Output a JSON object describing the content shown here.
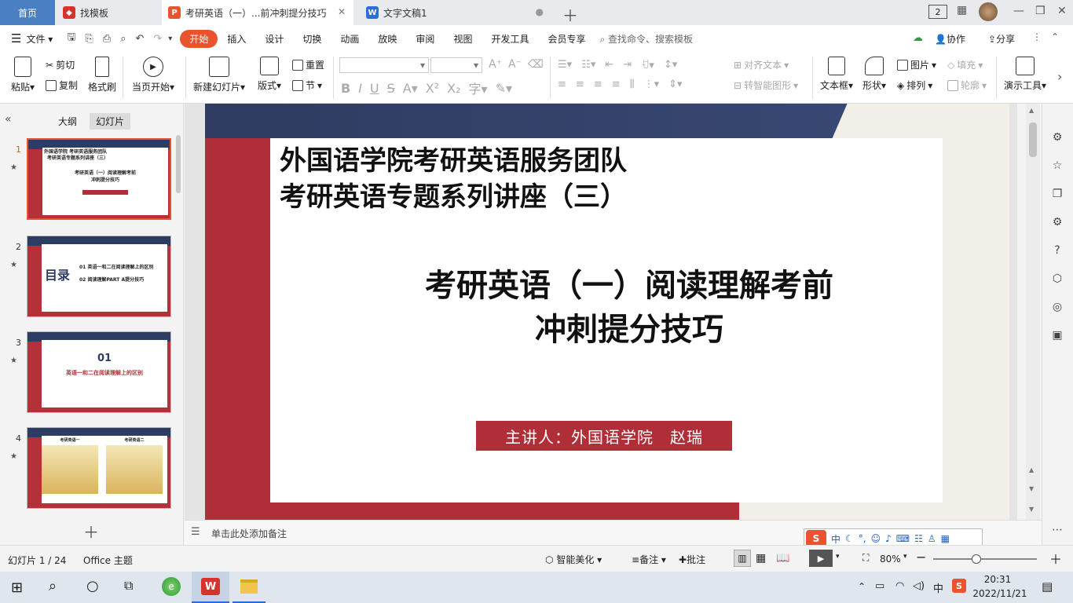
{
  "tabs": {
    "home": "首页",
    "template": "找模板",
    "active_doc": "考研英语（一）...前冲刺提分技巧",
    "text_doc": "文字文稿1"
  },
  "window": {
    "badge": "2"
  },
  "menu": {
    "file": "文件",
    "items": [
      "开始",
      "插入",
      "设计",
      "切换",
      "动画",
      "放映",
      "审阅",
      "视图",
      "开发工具",
      "会员专享"
    ],
    "search": "查找命令、搜索模板",
    "collab": "协作",
    "share": "分享"
  },
  "ribbon": {
    "paste": "粘贴",
    "cut": "剪切",
    "copy": "复制",
    "format_painter": "格式刷",
    "from_current": "当页开始",
    "new_slide": "新建幻灯片",
    "layout": "版式",
    "reset": "重置",
    "section": "节",
    "align_text": "对齐文本",
    "smart_shape": "转智能图形",
    "textbox": "文本框",
    "shape": "形状",
    "picture": "图片",
    "fill": "填充",
    "arrange": "排列",
    "outline": "轮廓",
    "presenter_tools": "演示工具"
  },
  "panel": {
    "outline_tab": "大纲",
    "slides_tab": "幻灯片",
    "thumbs": [
      {
        "num": "1",
        "line1": "外国语学院 考研英语服务团队",
        "line2": "考研英语专题系列讲座（三）",
        "line3": "考研英语（一）阅读理解考前",
        "line4": "冲刺提分技巧"
      },
      {
        "num": "2",
        "title": "目录",
        "item1": "01 英语一和二在阅读理解上的区别",
        "item2": "02 阅读理解PART A提分技巧"
      },
      {
        "num": "3",
        "big": "01",
        "sub": "英语一和二在阅读理解上的区别"
      },
      {
        "num": "4",
        "h1": "考研英语一",
        "h2": "考研英语二"
      }
    ]
  },
  "slide": {
    "title_line1": "外国语学院考研英语服务团队",
    "title_line2": "考研英语专题系列讲座（三）",
    "main_line1": "考研英语（一）阅读理解考前",
    "main_line2": "冲刺提分技巧",
    "lecturer": "主讲人：外国语学院　赵瑞"
  },
  "notes_placeholder": "单击此处添加备注",
  "status": {
    "slide_count": "幻灯片 1 / 24",
    "theme": "Office 主题",
    "beautify": "智能美化",
    "notes": "备注",
    "comments": "批注",
    "zoom": "80%",
    "zoom_fraction": 0.42
  },
  "ime": {
    "mode": "中"
  },
  "taskbar": {
    "ime": "中",
    "time": "20:31",
    "date": "2022/11/21"
  },
  "colors": {
    "accent": "#e9542f",
    "slide_red": "#b02e37",
    "slide_navy": "#2f3b60",
    "home_tab": "#4a7fc1"
  }
}
